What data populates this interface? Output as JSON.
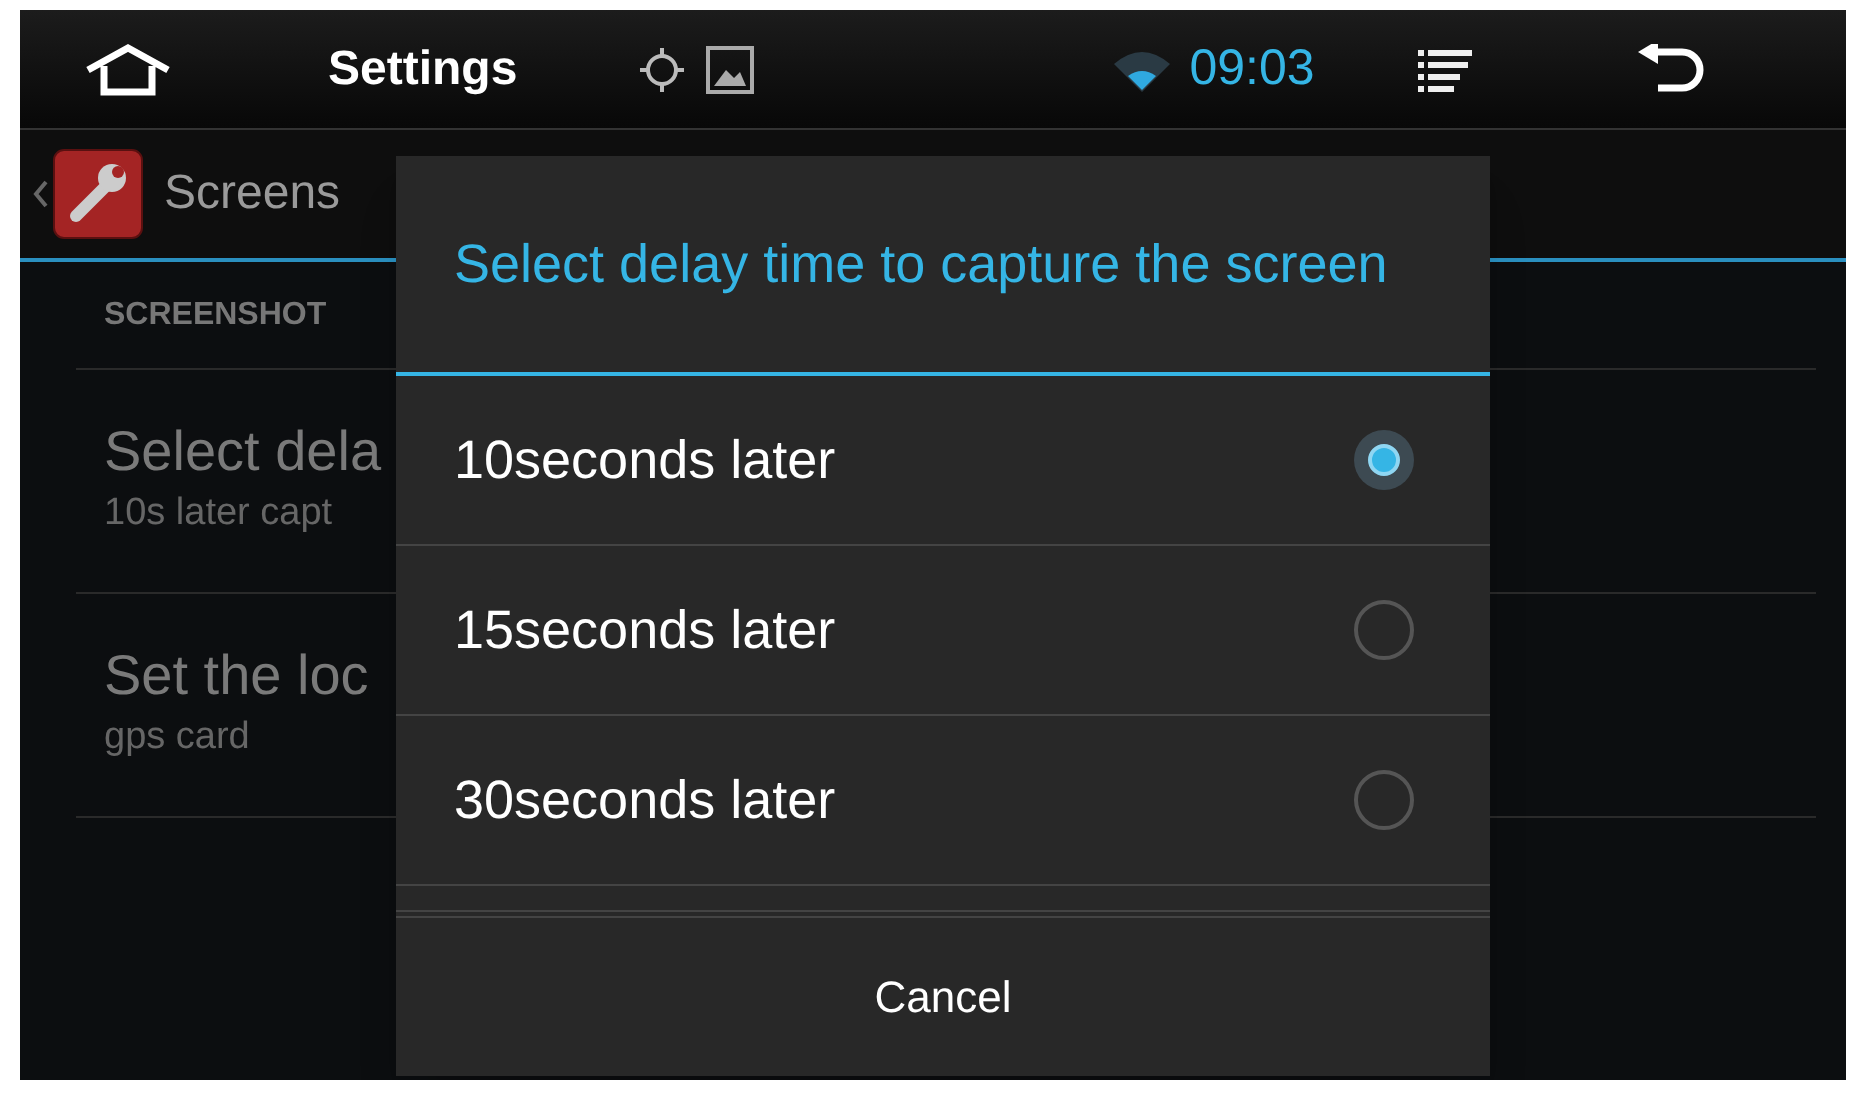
{
  "status_bar": {
    "title": "Settings",
    "time": "09:03"
  },
  "action_bar": {
    "title": "Screens"
  },
  "background_list": {
    "section_header": "SCREENSHOT",
    "items": [
      {
        "title": "Select dela",
        "summary": "10s later capt"
      },
      {
        "title": "Set the loc",
        "summary": "gps card"
      }
    ]
  },
  "dialog": {
    "title": "Select delay time to capture the screen",
    "options": [
      {
        "label": "10seconds later",
        "selected": true
      },
      {
        "label": "15seconds later",
        "selected": false
      },
      {
        "label": "30seconds later",
        "selected": false
      }
    ],
    "cancel": "Cancel"
  }
}
